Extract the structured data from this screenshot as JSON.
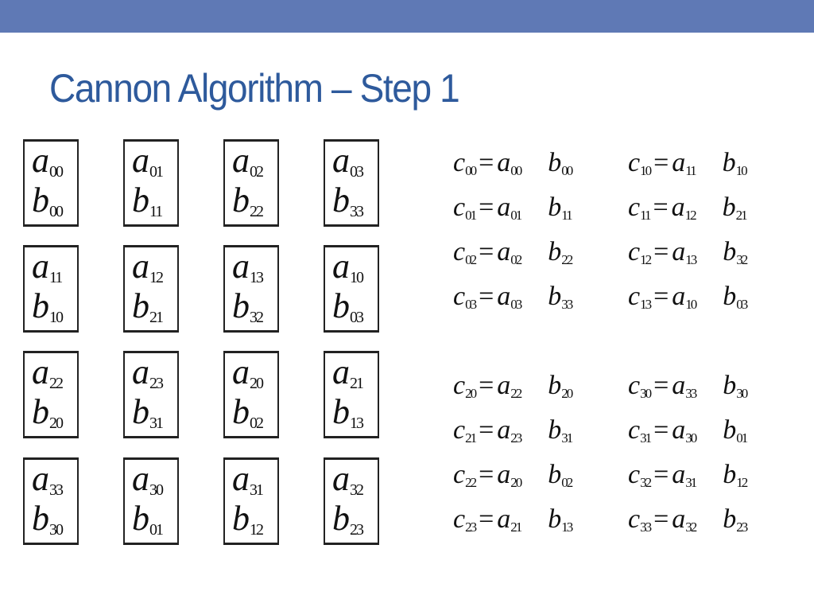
{
  "header": {
    "title": "Cannon Algorithm – Step 1"
  },
  "colors": {
    "topbar": "#5f79b5",
    "title": "#2e5a9c"
  },
  "grid": {
    "rows": [
      [
        {
          "a": "00",
          "b": "00"
        },
        {
          "a": "01",
          "b": "11"
        },
        {
          "a": "02",
          "b": "22"
        },
        {
          "a": "03",
          "b": "33"
        }
      ],
      [
        {
          "a": "11",
          "b": "10"
        },
        {
          "a": "12",
          "b": "21"
        },
        {
          "a": "13",
          "b": "32"
        },
        {
          "a": "10",
          "b": "03"
        }
      ],
      [
        {
          "a": "22",
          "b": "20"
        },
        {
          "a": "23",
          "b": "31"
        },
        {
          "a": "20",
          "b": "02"
        },
        {
          "a": "21",
          "b": "13"
        }
      ],
      [
        {
          "a": "33",
          "b": "30"
        },
        {
          "a": "30",
          "b": "01"
        },
        {
          "a": "31",
          "b": "12"
        },
        {
          "a": "32",
          "b": "23"
        }
      ]
    ]
  },
  "equations": {
    "groups": [
      [
        [
          {
            "c": "00",
            "a": "00",
            "b": "00"
          },
          {
            "c": "10",
            "a": "11",
            "b": "10"
          }
        ],
        [
          {
            "c": "01",
            "a": "01",
            "b": "11"
          },
          {
            "c": "11",
            "a": "12",
            "b": "21"
          }
        ],
        [
          {
            "c": "02",
            "a": "02",
            "b": "22"
          },
          {
            "c": "12",
            "a": "13",
            "b": "32"
          }
        ],
        [
          {
            "c": "03",
            "a": "03",
            "b": "33"
          },
          {
            "c": "13",
            "a": "10",
            "b": "03"
          }
        ]
      ],
      [
        [
          {
            "c": "20",
            "a": "22",
            "b": "20"
          },
          {
            "c": "30",
            "a": "33",
            "b": "30"
          }
        ],
        [
          {
            "c": "21",
            "a": "23",
            "b": "31"
          },
          {
            "c": "31",
            "a": "30",
            "b": "01"
          }
        ],
        [
          {
            "c": "22",
            "a": "20",
            "b": "02"
          },
          {
            "c": "32",
            "a": "31",
            "b": "12"
          }
        ],
        [
          {
            "c": "23",
            "a": "21",
            "b": "13"
          },
          {
            "c": "33",
            "a": "32",
            "b": "23"
          }
        ]
      ]
    ],
    "symbols": {
      "c": "c",
      "a": "a",
      "b": "b",
      "equals": "="
    }
  }
}
